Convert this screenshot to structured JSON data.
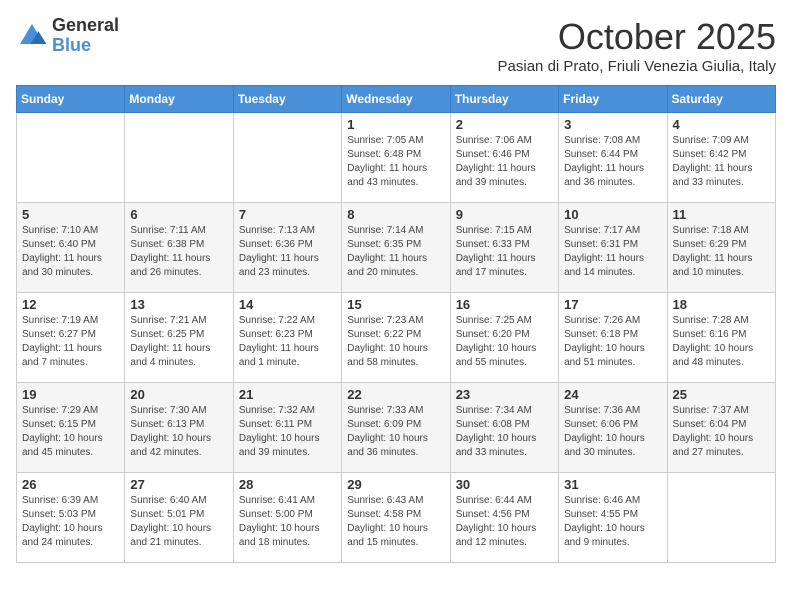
{
  "logo": {
    "general": "General",
    "blue": "Blue"
  },
  "header": {
    "month": "October 2025",
    "subtitle": "Pasian di Prato, Friuli Venezia Giulia, Italy"
  },
  "weekdays": [
    "Sunday",
    "Monday",
    "Tuesday",
    "Wednesday",
    "Thursday",
    "Friday",
    "Saturday"
  ],
  "weeks": [
    [
      {
        "day": "",
        "info": ""
      },
      {
        "day": "",
        "info": ""
      },
      {
        "day": "",
        "info": ""
      },
      {
        "day": "1",
        "info": "Sunrise: 7:05 AM\nSunset: 6:48 PM\nDaylight: 11 hours and 43 minutes."
      },
      {
        "day": "2",
        "info": "Sunrise: 7:06 AM\nSunset: 6:46 PM\nDaylight: 11 hours and 39 minutes."
      },
      {
        "day": "3",
        "info": "Sunrise: 7:08 AM\nSunset: 6:44 PM\nDaylight: 11 hours and 36 minutes."
      },
      {
        "day": "4",
        "info": "Sunrise: 7:09 AM\nSunset: 6:42 PM\nDaylight: 11 hours and 33 minutes."
      }
    ],
    [
      {
        "day": "5",
        "info": "Sunrise: 7:10 AM\nSunset: 6:40 PM\nDaylight: 11 hours and 30 minutes."
      },
      {
        "day": "6",
        "info": "Sunrise: 7:11 AM\nSunset: 6:38 PM\nDaylight: 11 hours and 26 minutes."
      },
      {
        "day": "7",
        "info": "Sunrise: 7:13 AM\nSunset: 6:36 PM\nDaylight: 11 hours and 23 minutes."
      },
      {
        "day": "8",
        "info": "Sunrise: 7:14 AM\nSunset: 6:35 PM\nDaylight: 11 hours and 20 minutes."
      },
      {
        "day": "9",
        "info": "Sunrise: 7:15 AM\nSunset: 6:33 PM\nDaylight: 11 hours and 17 minutes."
      },
      {
        "day": "10",
        "info": "Sunrise: 7:17 AM\nSunset: 6:31 PM\nDaylight: 11 hours and 14 minutes."
      },
      {
        "day": "11",
        "info": "Sunrise: 7:18 AM\nSunset: 6:29 PM\nDaylight: 11 hours and 10 minutes."
      }
    ],
    [
      {
        "day": "12",
        "info": "Sunrise: 7:19 AM\nSunset: 6:27 PM\nDaylight: 11 hours and 7 minutes."
      },
      {
        "day": "13",
        "info": "Sunrise: 7:21 AM\nSunset: 6:25 PM\nDaylight: 11 hours and 4 minutes."
      },
      {
        "day": "14",
        "info": "Sunrise: 7:22 AM\nSunset: 6:23 PM\nDaylight: 11 hours and 1 minute."
      },
      {
        "day": "15",
        "info": "Sunrise: 7:23 AM\nSunset: 6:22 PM\nDaylight: 10 hours and 58 minutes."
      },
      {
        "day": "16",
        "info": "Sunrise: 7:25 AM\nSunset: 6:20 PM\nDaylight: 10 hours and 55 minutes."
      },
      {
        "day": "17",
        "info": "Sunrise: 7:26 AM\nSunset: 6:18 PM\nDaylight: 10 hours and 51 minutes."
      },
      {
        "day": "18",
        "info": "Sunrise: 7:28 AM\nSunset: 6:16 PM\nDaylight: 10 hours and 48 minutes."
      }
    ],
    [
      {
        "day": "19",
        "info": "Sunrise: 7:29 AM\nSunset: 6:15 PM\nDaylight: 10 hours and 45 minutes."
      },
      {
        "day": "20",
        "info": "Sunrise: 7:30 AM\nSunset: 6:13 PM\nDaylight: 10 hours and 42 minutes."
      },
      {
        "day": "21",
        "info": "Sunrise: 7:32 AM\nSunset: 6:11 PM\nDaylight: 10 hours and 39 minutes."
      },
      {
        "day": "22",
        "info": "Sunrise: 7:33 AM\nSunset: 6:09 PM\nDaylight: 10 hours and 36 minutes."
      },
      {
        "day": "23",
        "info": "Sunrise: 7:34 AM\nSunset: 6:08 PM\nDaylight: 10 hours and 33 minutes."
      },
      {
        "day": "24",
        "info": "Sunrise: 7:36 AM\nSunset: 6:06 PM\nDaylight: 10 hours and 30 minutes."
      },
      {
        "day": "25",
        "info": "Sunrise: 7:37 AM\nSunset: 6:04 PM\nDaylight: 10 hours and 27 minutes."
      }
    ],
    [
      {
        "day": "26",
        "info": "Sunrise: 6:39 AM\nSunset: 5:03 PM\nDaylight: 10 hours and 24 minutes."
      },
      {
        "day": "27",
        "info": "Sunrise: 6:40 AM\nSunset: 5:01 PM\nDaylight: 10 hours and 21 minutes."
      },
      {
        "day": "28",
        "info": "Sunrise: 6:41 AM\nSunset: 5:00 PM\nDaylight: 10 hours and 18 minutes."
      },
      {
        "day": "29",
        "info": "Sunrise: 6:43 AM\nSunset: 4:58 PM\nDaylight: 10 hours and 15 minutes."
      },
      {
        "day": "30",
        "info": "Sunrise: 6:44 AM\nSunset: 4:56 PM\nDaylight: 10 hours and 12 minutes."
      },
      {
        "day": "31",
        "info": "Sunrise: 6:46 AM\nSunset: 4:55 PM\nDaylight: 10 hours and 9 minutes."
      },
      {
        "day": "",
        "info": ""
      }
    ]
  ]
}
